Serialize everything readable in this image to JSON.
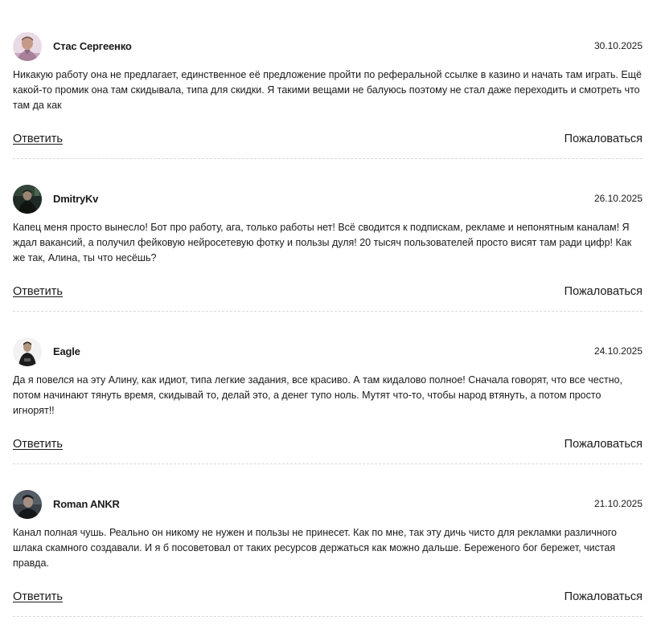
{
  "comments": [
    {
      "author": "Стас Сергеенко",
      "date": "30.10.2025",
      "text": "Никакую работу она не предлагает, единственное её предложение пройти по реферальной ссылке в казино и начать там играть. Ещё какой-то промик она там скидывала, типа для скидки. Я такими вещами не балуюсь поэтому не стал даже переходить и смотреть что там да как",
      "reply_label": "Ответить",
      "report_label": "Пожаловаться"
    },
    {
      "author": "DmitryKv",
      "date": "26.10.2025",
      "text": "Капец меня просто вынесло! Бот про работу, ага, только работы нет! Всё сводится к подпискам, рекламе и непонятным каналам! Я ждал вакансий, а получил фейковую нейросетевую фотку и пользы дуля! 20 тысяч пользователей просто висят там ради цифр! Как же так, Алина, ты что несёшь?",
      "reply_label": "Ответить",
      "report_label": "Пожаловаться"
    },
    {
      "author": "Eagle",
      "date": "24.10.2025",
      "text": "Да я повелся на эту Алину, как идиот, типа легкие задания, все красиво. А там кидалово полное! Сначала говорят, что все честно, потом начинают тянуть время, скидывай то, делай это, а денег тупо ноль. Мутят что-то, чтобы народ втянуть, а потом просто игнорят!!",
      "reply_label": "Ответить",
      "report_label": "Пожаловаться"
    },
    {
      "author": "Roman ANKR",
      "date": "21.10.2025",
      "text": "Канал полная чушь. Реально он никому не нужен и пользы не принесет. Как по мне, так эту дичь чисто для рекламки различного шлака скамного создавали. И я б посоветовал от таких ресурсов держаться как можно дальше. Береженого бог бережет, чистая правда.",
      "reply_label": "Ответить",
      "report_label": "Пожаловаться"
    }
  ]
}
